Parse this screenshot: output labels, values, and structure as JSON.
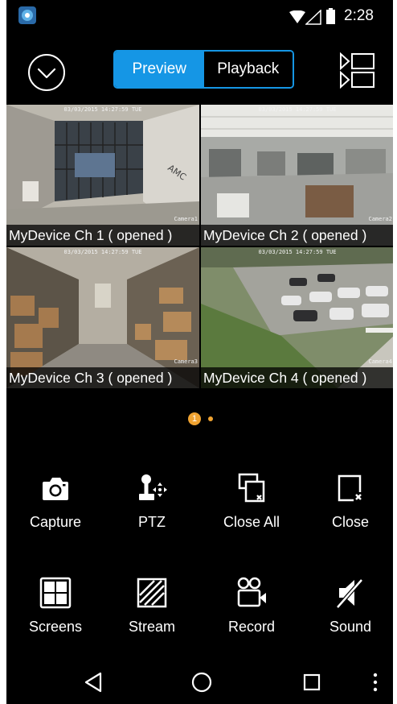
{
  "status_bar": {
    "time": "2:28",
    "icons": [
      "app-notification-icon",
      "wifi-icon",
      "cell-signal-icon",
      "battery-icon"
    ]
  },
  "header": {
    "menu_icon": "chevron-down-circle-icon",
    "tabs": [
      {
        "label": "Preview",
        "active": true
      },
      {
        "label": "Playback",
        "active": false
      }
    ],
    "layout_icon": "view-list-icon"
  },
  "channels": [
    {
      "caption": "MyDevice Ch 1 ( opened )",
      "timestamp": "03/03/2015 14:27:59 TUE",
      "camera": "Camera1",
      "selected": true
    },
    {
      "caption": "MyDevice Ch 2 ( opened )",
      "timestamp": "03/03/2015 14:27:59 TUE",
      "camera": "Camera2",
      "selected": false
    },
    {
      "caption": "MyDevice Ch 3 ( opened )",
      "timestamp": "03/03/2015 14:27:59 TUE",
      "camera": "Camera3",
      "selected": false
    },
    {
      "caption": "MyDevice Ch 4 ( opened )",
      "timestamp": "03/03/2015 14:27:59 TUE",
      "camera": "Camera4",
      "selected": false
    }
  ],
  "pager": {
    "current": "1",
    "total_pages": 2
  },
  "controls": [
    {
      "label": "Capture",
      "icon": "camera-icon"
    },
    {
      "label": "PTZ",
      "icon": "ptz-joystick-icon"
    },
    {
      "label": "Close All",
      "icon": "close-all-icon"
    },
    {
      "label": "Close",
      "icon": "close-window-icon"
    },
    {
      "label": "Screens",
      "icon": "grid-screens-icon"
    },
    {
      "label": "Stream",
      "icon": "stream-icon"
    },
    {
      "label": "Record",
      "icon": "video-record-icon"
    },
    {
      "label": "Sound",
      "icon": "sound-muted-icon"
    }
  ],
  "nav_bar": {
    "icons": [
      "back-icon",
      "home-icon",
      "recents-icon",
      "more-icon"
    ]
  },
  "colors": {
    "accent": "#1596e5",
    "selected_border": "#d33a3a",
    "pager_dot": "#f0a331",
    "background": "#000000"
  }
}
